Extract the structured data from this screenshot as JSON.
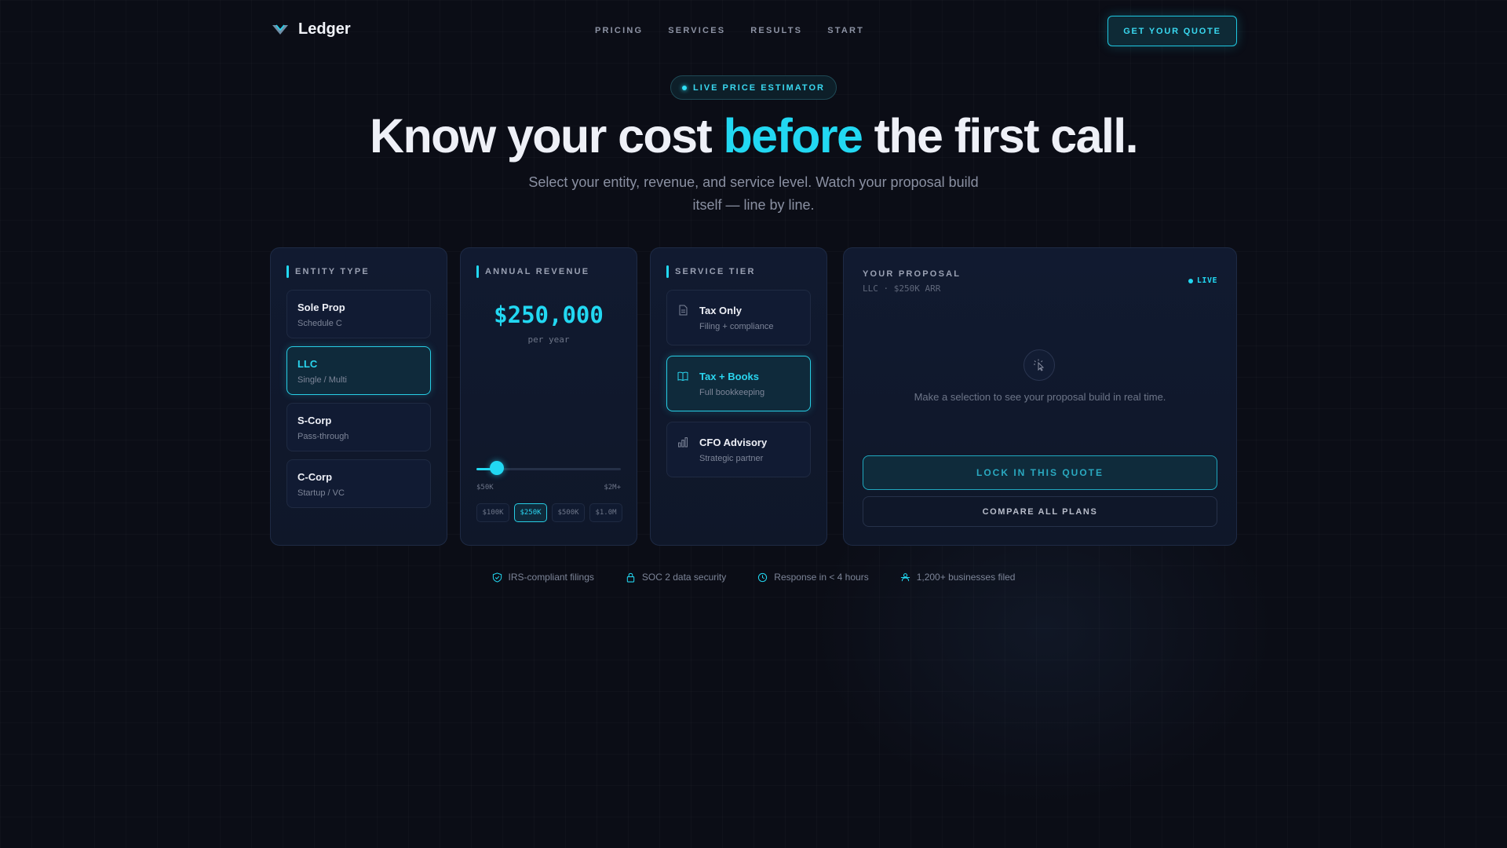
{
  "nav": {
    "logo_text": "Ledger",
    "links": [
      "PRICING",
      "SERVICES",
      "RESULTS",
      "START"
    ],
    "cta_label": "GET YOUR QUOTE"
  },
  "hero": {
    "badge": "LIVE PRICE ESTIMATOR",
    "headline_pre": "Know your cost ",
    "headline_accent": "before",
    "headline_post": " the first call.",
    "subtitle": "Select your entity, revenue, and service level. Watch your proposal build itself — line by line."
  },
  "entity": {
    "heading": "ENTITY TYPE",
    "options": [
      {
        "title": "Sole Prop",
        "sub": "Schedule C",
        "selected": false
      },
      {
        "title": "LLC",
        "sub": "Single / Multi",
        "selected": true
      },
      {
        "title": "S-Corp",
        "sub": "Pass-through",
        "selected": false
      },
      {
        "title": "C-Corp",
        "sub": "Startup / VC",
        "selected": false
      }
    ]
  },
  "revenue": {
    "heading": "ANNUAL REVENUE",
    "amount": "$250,000",
    "period": "per year",
    "slider_fraction": 0.14,
    "min_label": "$50K",
    "max_label": "$2M+",
    "presets": [
      {
        "label": "$100K",
        "selected": false
      },
      {
        "label": "$250K",
        "selected": true
      },
      {
        "label": "$500K",
        "selected": false
      },
      {
        "label": "$1.0M",
        "selected": false
      }
    ]
  },
  "tier": {
    "heading": "SERVICE TIER",
    "options": [
      {
        "title": "Tax Only",
        "sub": "Filing + compliance",
        "icon": "document-icon",
        "selected": false
      },
      {
        "title": "Tax + Books",
        "sub": "Full bookkeeping",
        "icon": "book-icon",
        "selected": true
      },
      {
        "title": "CFO Advisory",
        "sub": "Strategic partner",
        "icon": "bar-chart-icon",
        "selected": false
      }
    ]
  },
  "proposal": {
    "title": "YOUR PROPOSAL",
    "subtitle": "LLC · $250K ARR",
    "live": "LIVE",
    "empty_text": "Make a selection to see your proposal build in real time.",
    "lock_label": "LOCK IN THIS QUOTE",
    "compare_label": "COMPARE ALL PLANS"
  },
  "trust": [
    {
      "icon": "shield-check-icon",
      "label": "IRS-compliant filings"
    },
    {
      "icon": "lock-icon",
      "label": "SOC 2 data security"
    },
    {
      "icon": "clock-icon",
      "label": "Response in < 4 hours"
    },
    {
      "icon": "users-icon",
      "label": "1,200+ businesses filed"
    }
  ],
  "colors": {
    "accent": "#22d8f2",
    "background": "#0b0d16",
    "panel": "#111a30"
  }
}
